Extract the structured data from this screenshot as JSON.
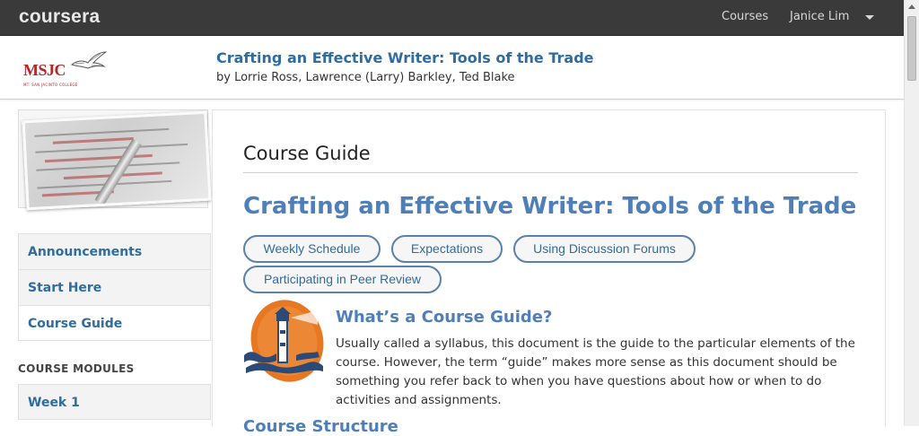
{
  "topbar": {
    "brand": "coursera",
    "courses_label": "Courses",
    "user_name": "Janice Lim"
  },
  "header": {
    "logo_text": "MSJC",
    "logo_subtext": "MT. SAN JACINTO COLLEGE",
    "course_title": "Crafting an Effective Writer: Tools of the Trade",
    "authors": "by Lorrie Ross, Lawrence (Larry) Barkley, Ted Blake"
  },
  "sidebar": {
    "items": [
      {
        "label": "Announcements"
      },
      {
        "label": "Start Here"
      },
      {
        "label": "Course Guide"
      }
    ],
    "section_label": "COURSE MODULES",
    "modules": [
      {
        "label": "Week 1"
      }
    ]
  },
  "main": {
    "heading": "Course Guide",
    "title": "Crafting an Effective Writer: Tools of the Trade",
    "buttons": [
      {
        "label": "Weekly Schedule"
      },
      {
        "label": "Expectations"
      },
      {
        "label": "Using Discussion Forums"
      },
      {
        "label": "Participating in Peer Review"
      }
    ],
    "section_heading": "What’s a Course Guide?",
    "section_text": "Usually called a syllabus, this document is the guide to the particular elements of the course. However, the term “guide” makes more sense as this document should be something you refer back to when you have questions about how or when to do activities and assignments.",
    "next_heading": "Course Structure"
  },
  "colors": {
    "topbar": "#3a3a3a",
    "link_blue": "#2f6c9f",
    "heading_blue": "#4f7fb8",
    "logo_red": "#b3262a",
    "lighthouse_orange": "#e87722"
  }
}
